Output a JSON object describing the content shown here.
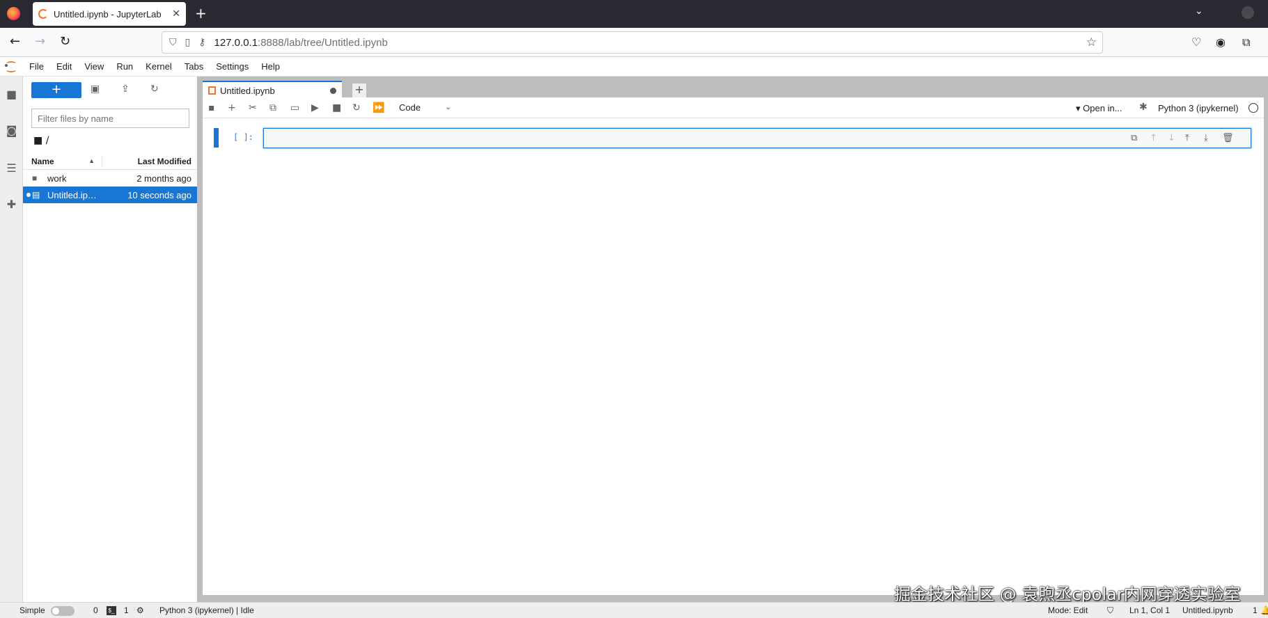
{
  "browser": {
    "tab_title": "Untitled.ipynb - JupyterLab",
    "new_tab": "+",
    "tab_list": "⌄",
    "close": "✕",
    "url_host": "127.0.0.1",
    "url_path": ":8888/lab/tree/Untitled.ipynb",
    "icons": [
      "back-icon",
      "forward-icon",
      "reload-icon",
      "shield-icon",
      "page-icon",
      "key-icon",
      "star-icon",
      "pocket-icon",
      "account-icon",
      "extensions-icon"
    ]
  },
  "menu": {
    "items": [
      "File",
      "Edit",
      "View",
      "Run",
      "Kernel",
      "Tabs",
      "Settings",
      "Help"
    ]
  },
  "filebrowser": {
    "new_label": "+",
    "filter_placeholder": "Filter files by name",
    "breadcrumb": "/",
    "col_name": "Name",
    "col_modified": "Last Modified",
    "rows": [
      {
        "name": "work",
        "modified": "2 months ago",
        "type": "folder"
      },
      {
        "name": "Untitled.ip…",
        "modified": "10 seconds ago",
        "type": "notebook",
        "selected": true
      }
    ]
  },
  "notebook": {
    "tab_label": "Untitled.ipynb",
    "add_tab": "+",
    "cell_type": "Code",
    "open_in": "Open in...",
    "kernel": "Python 3 (ipykernel)",
    "prompt": "[ ]:"
  },
  "watermark": "掘金技术社区 @ 袁煦丞cpolar内网穿透实验室",
  "status": {
    "mode_toggle_label": "Simple",
    "terminals_count": "0",
    "kernels_count": "1",
    "kernel_status": "Python 3 (ipykernel) | Idle",
    "mode": "Mode: Edit",
    "cursor": "Ln 1, Col 1",
    "file": "Untitled.ipynb",
    "tab_count": "1"
  },
  "colors": {
    "accent": "#1976d2",
    "jupyter_orange": "#f37626",
    "browser_dark": "#2b2a33"
  }
}
